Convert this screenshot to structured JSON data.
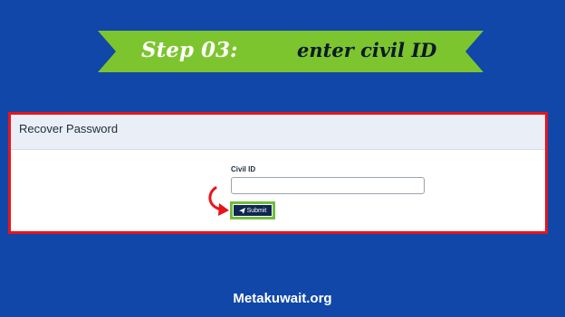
{
  "banner": {
    "step_label": "Step 03:",
    "step_text": "enter civil ID",
    "color": "#7dc52e"
  },
  "form": {
    "title": "Recover Password",
    "field_label": "Civil ID",
    "field_value": "",
    "submit_label": "Submit",
    "submit_icon": "send-icon",
    "pointer_icon": "curved-arrow-icon"
  },
  "footer": {
    "site": "Metakuwait.org"
  },
  "colors": {
    "background": "#1047a8",
    "highlight_border": "#e8141b",
    "button_bg": "#0f2650",
    "button_highlight": "#6dbf3a"
  }
}
